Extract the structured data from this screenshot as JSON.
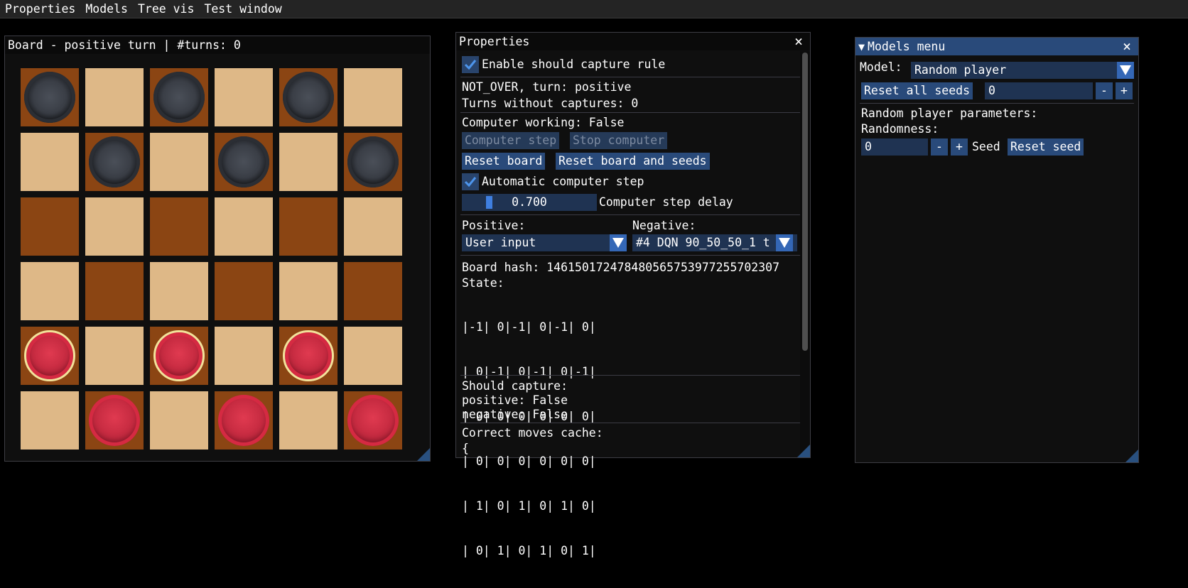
{
  "menubar": [
    "Properties",
    "Models",
    "Tree vis",
    "Test window"
  ],
  "board_window": {
    "title": "Board - positive turn | #turns: 0",
    "rows": [
      [
        "B",
        "L",
        "B",
        "L",
        "B",
        "L"
      ],
      [
        "L",
        "B",
        "L",
        "B",
        "L",
        "B"
      ],
      [
        "D",
        "L",
        "D",
        "L",
        "D",
        "L"
      ],
      [
        "L",
        "D",
        "L",
        "D",
        "L",
        "D"
      ],
      [
        "Rh",
        "L",
        "Rh",
        "L",
        "Rh",
        "L"
      ],
      [
        "L",
        "R",
        "L",
        "R",
        "L",
        "R"
      ]
    ],
    "colors": {
      "light": "#deb887",
      "dark": "#8b4513",
      "black_piece": "#2b2e34",
      "red_piece": "#d52a42",
      "highlight": "#f2e29a"
    }
  },
  "properties": {
    "title": "Properties",
    "close_icon": "×",
    "enable_capture_label": "Enable should capture rule",
    "status_line": "NOT_OVER, turn: positive",
    "turns_without_captures": "Turns without captures: 0",
    "computer_working": "Computer working: False",
    "computer_step_btn": "Computer step",
    "stop_computer_btn": "Stop computer",
    "reset_board_btn": "Reset board",
    "reset_board_seeds_btn": "Reset board and seeds",
    "automatic_step_label": "Automatic computer step",
    "step_delay_value": "0.700",
    "step_delay_label": "Computer step delay",
    "positive_label": "Positive:",
    "negative_label": "Negative:",
    "positive_value": "User input",
    "negative_value": "#4 DQN 90_50_50_1 t",
    "board_hash": "Board hash: 146150172478480565753977255702307",
    "state_label": "State:",
    "state_rows": [
      "|-1| 0|-1| 0|-1| 0|",
      "| 0|-1| 0|-1| 0|-1|",
      "| 0| 0| 0| 0| 0| 0|",
      "| 0| 0| 0| 0| 0| 0|",
      "| 1| 0| 1| 0| 1| 0|",
      "| 0| 1| 0| 1| 0| 1|"
    ],
    "should_capture": "Should capture:",
    "positive_capture": "positive: False",
    "negative_capture": "negative: False",
    "moves_cache": "Correct moves cache:",
    "brace": "{"
  },
  "models": {
    "title": "Models menu",
    "collapse_icon": "▼",
    "close_icon": "×",
    "model_label": "Model:",
    "model_value": "Random player",
    "reset_all_seeds_btn": "Reset all seeds",
    "seeds_value": "0",
    "minus": "-",
    "plus": "+",
    "random_params": "Random player parameters:",
    "randomness_label": "Randomness:",
    "randomness_value": "0",
    "seed_label": "Seed",
    "reset_seed_btn": "Reset seed"
  }
}
